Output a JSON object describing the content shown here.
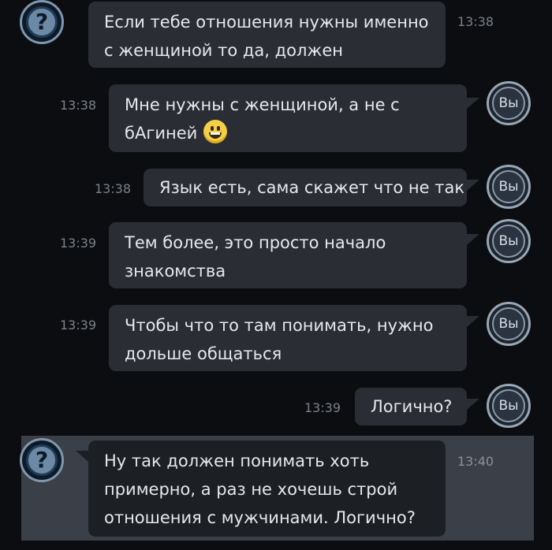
{
  "participants": {
    "anon_avatar_glyph": "?",
    "me_avatar_label": "Вы"
  },
  "messages": [
    {
      "from": "anon",
      "lines": [
        "Если тебе отношения нужны именно",
        "с женщиной то да, должен"
      ],
      "time": "13:38"
    },
    {
      "from": "me",
      "lines": [
        "Мне нужны с женщиной, а не с",
        "бАгиней"
      ],
      "emoji": "grinning-face",
      "time": "13:38"
    },
    {
      "from": "me",
      "lines": [
        "Язык есть, сама скажет что не так"
      ],
      "time": "13:38"
    },
    {
      "from": "me",
      "lines": [
        "Тем более, это просто начало",
        "знакомства"
      ],
      "time": "13:39"
    },
    {
      "from": "me",
      "lines": [
        "Чтобы что то там понимать, нужно",
        "дольше общаться"
      ],
      "time": "13:39"
    },
    {
      "from": "me",
      "lines": [
        "Логично?"
      ],
      "time": "13:39"
    },
    {
      "from": "anon",
      "lines": [
        "Ну так должен понимать хоть",
        "примерно, а раз не хочешь строй",
        "отношения с мужчинами. Логично?"
      ],
      "time": "13:40",
      "highlighted": true
    }
  ],
  "colors": {
    "background": "#0c0d10",
    "bubble": "#2a2d33",
    "highlight": "#3b4048",
    "time_text": "#7b8087",
    "anon_avatar": "#6c8aa6"
  }
}
